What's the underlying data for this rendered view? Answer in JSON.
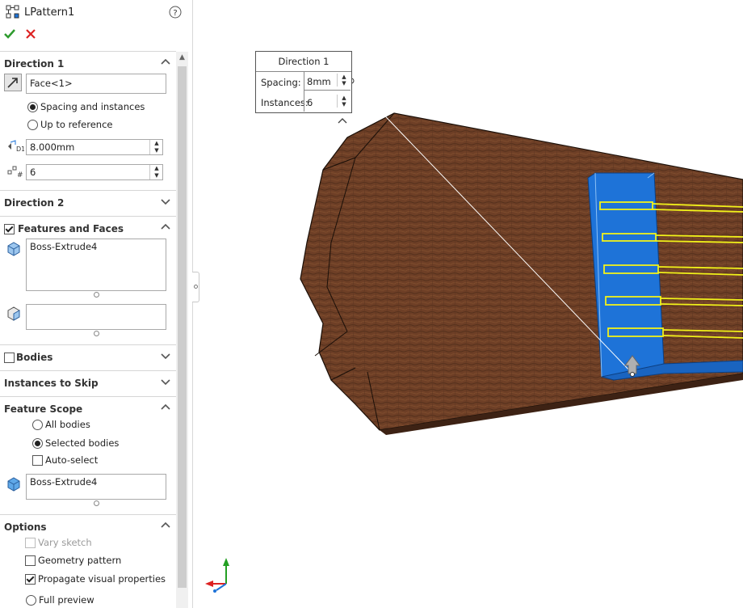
{
  "feature": {
    "title": "LPattern1"
  },
  "sections": {
    "direction1": "Direction 1",
    "direction2": "Direction 2",
    "features_faces": "Features and Faces",
    "bodies": "Bodies",
    "instances_to_skip": "Instances to Skip",
    "feature_scope": "Feature Scope",
    "options": "Options"
  },
  "direction1": {
    "reference": "Face<1>",
    "radio_spacing": "Spacing and instances",
    "radio_reference": "Up to reference",
    "spacing": "8.000mm",
    "instances": "6"
  },
  "features_faces": {
    "features_list": "Boss-Extrude4",
    "faces_list": ""
  },
  "feature_scope": {
    "all_bodies": "All bodies",
    "selected_bodies": "Selected bodies",
    "auto_select": "Auto-select",
    "bodies_list": "Boss-Extrude4"
  },
  "options": {
    "vary_sketch": "Vary sketch",
    "geometry_pattern": "Geometry pattern",
    "propagate_visual": "Propagate visual properties",
    "full_preview": "Full preview"
  },
  "callout": {
    "title": "Direction 1",
    "spacing_label": "Spacing:",
    "spacing_value": "8mm",
    "instances_label": "Instances:",
    "instances_value": "6"
  },
  "colors": {
    "accent_blue": "#1e73d8",
    "highlight_yellow": "#f2f21a",
    "wood": "#6e3f26",
    "ok_green": "#2e9b2e",
    "cancel_red": "#d22"
  }
}
